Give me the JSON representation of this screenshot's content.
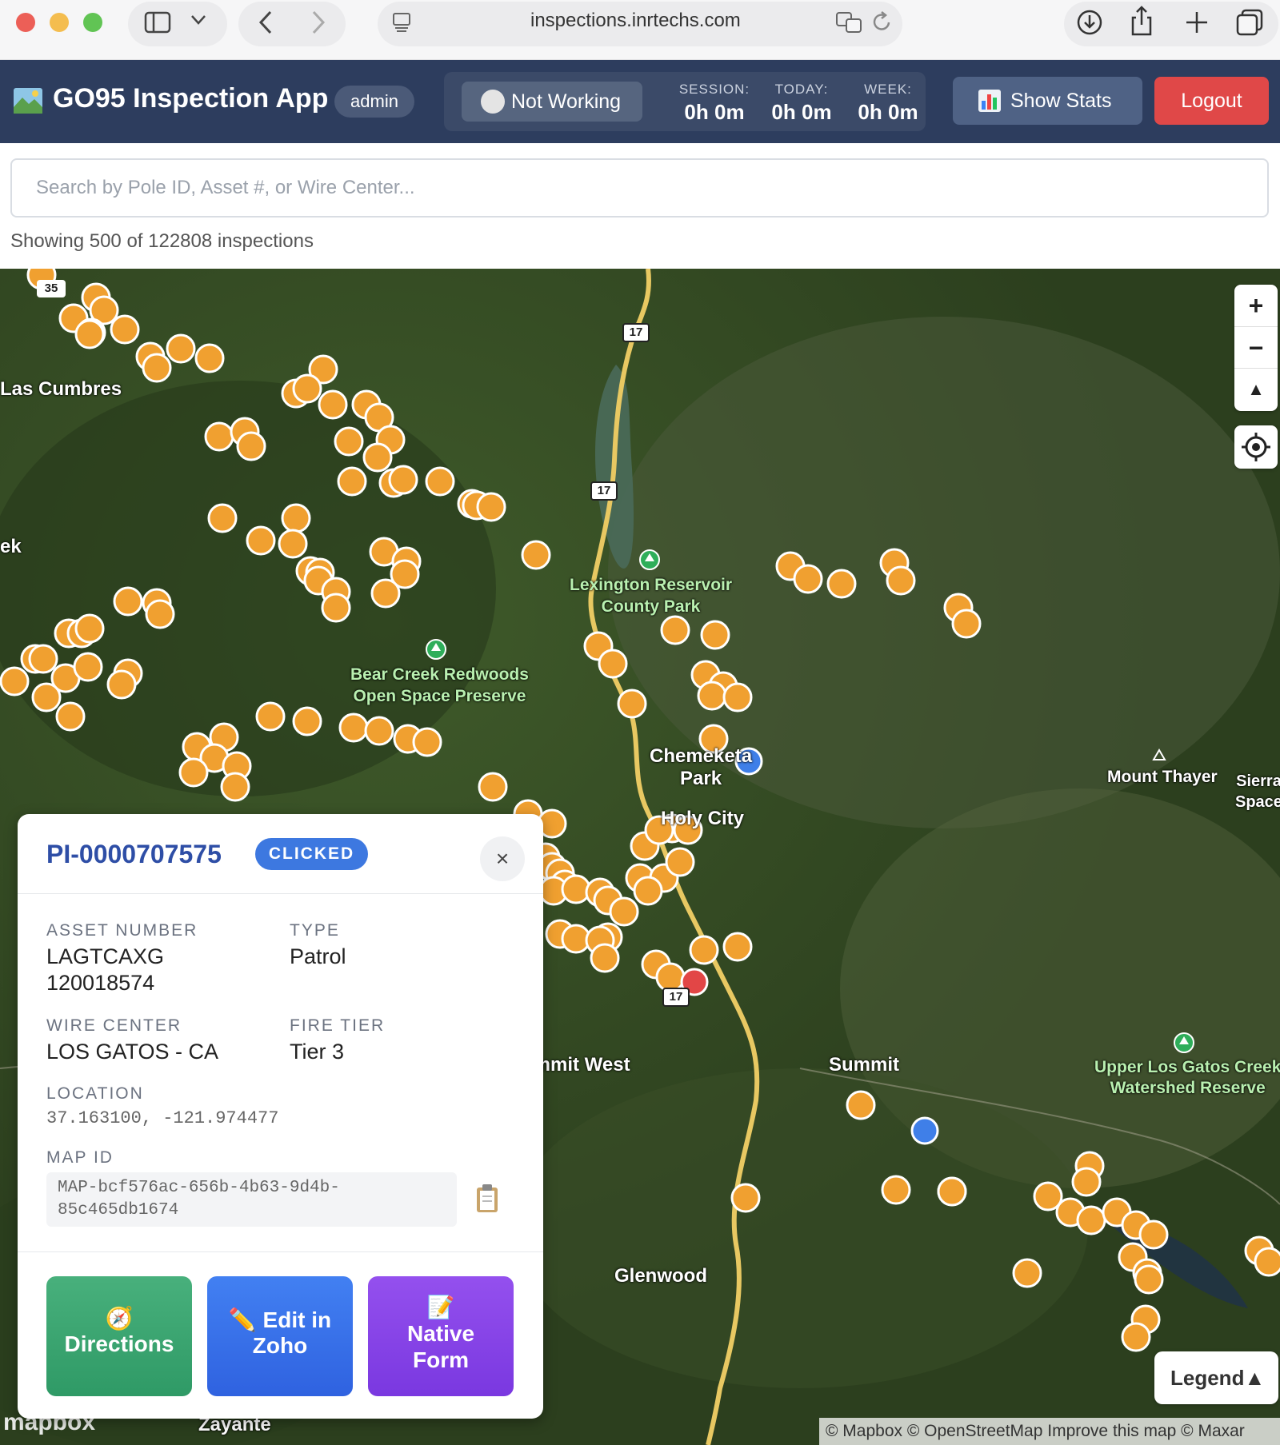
{
  "browser": {
    "url": "inspections.inrtechs.com",
    "icons": [
      "sidebar-icon",
      "chevron-down-icon",
      "back-icon",
      "forward-icon",
      "tab-overview-icon",
      "translate-icon",
      "reload-icon",
      "download-icon",
      "share-icon",
      "new-tab-icon",
      "tabs-icon"
    ]
  },
  "header": {
    "title": "GO95 Inspection App",
    "role_badge": "admin",
    "work_status": "Not Working",
    "session_label": "SESSION:",
    "session_value": "0h 0m",
    "today_label": "TODAY:",
    "today_value": "0h 0m",
    "week_label": "WEEK:",
    "week_value": "0h 0m",
    "stats_button": "Show Stats",
    "logout_button": "Logout"
  },
  "search": {
    "placeholder": "Search by Pole ID, Asset #, or Wire Center...",
    "value": ""
  },
  "results": {
    "summary": "Showing 500 of 122808 inspections"
  },
  "map": {
    "places": {
      "las_cumbres": "Las Cumbres",
      "ek": "ek",
      "lexington": "Lexington Reservoir\nCounty Park",
      "bear_creek": "Bear Creek Redwoods\nOpen Space Preserve",
      "chemeketa": "Chemeketa\nPark",
      "holy_city": "Holy City",
      "mount_thayer": "Mount Thayer",
      "sierra": "Sierra\nSpace",
      "summit": "Summit",
      "summit_west": "Summit West",
      "upper_los_gatos": "Upper Los Gatos Creek\nWatershed Reserve",
      "glenwood": "Glenwood",
      "zayante": "Zayante"
    },
    "route_shields": [
      "35",
      "17",
      "17",
      "17"
    ],
    "marker_colors": {
      "inspection": "#f0a030",
      "blue": "#3f7fe8",
      "red": "#e24646"
    },
    "zoom_in": "+",
    "zoom_out": "−",
    "compass": "▲",
    "legend": "Legend▲",
    "attribution": "© Mapbox © OpenStreetMap  Improve this map © Maxar",
    "logo": "mapbox"
  },
  "popup": {
    "pole_id": "PI-0000707575",
    "status_badge": "CLICKED",
    "close": "×",
    "asset_number_label": "ASSET NUMBER",
    "asset_number": "LAGTCAXG\n120018574",
    "type_label": "TYPE",
    "type": "Patrol",
    "wire_center_label": "WIRE CENTER",
    "wire_center": "LOS GATOS - CA",
    "fire_tier_label": "FIRE TIER",
    "fire_tier": "Tier 3",
    "location_label": "LOCATION",
    "location": "37.163100, -121.974477",
    "map_id_label": "MAP ID",
    "map_id": "MAP-bcf576ac-656b-4b63-9d4b-85c465db1674",
    "directions_button": "Directions",
    "edit_button": "Edit in Zoho",
    "native_form_button": "Native Form"
  },
  "colors": {
    "header_bg": "#2d3d5e",
    "logout": "#e04848",
    "directions": "#3bab73",
    "edit": "#3a6cf0",
    "native_form": "#8a46e8",
    "pole_id": "#2e4ea6"
  }
}
